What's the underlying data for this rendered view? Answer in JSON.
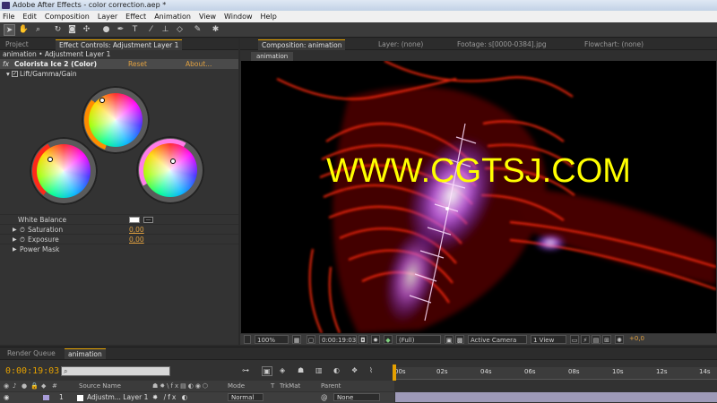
{
  "window": {
    "title": "Adobe After Effects - color correction.aep *"
  },
  "menu": [
    "File",
    "Edit",
    "Composition",
    "Layer",
    "Effect",
    "Animation",
    "View",
    "Window",
    "Help"
  ],
  "left_panel": {
    "tabs": {
      "project": "Project",
      "effect_controls": "Effect Controls: Adjustment Layer 1"
    },
    "breadcrumb": "animation • Adjustment Layer 1",
    "effect": {
      "prefix": "fx",
      "name": "Colorista Ice 2 (Color)",
      "reset": "Reset",
      "about": "About..."
    },
    "group": "Lift/Gamma/Gain",
    "props": [
      {
        "label": "White Balance",
        "value": ""
      },
      {
        "label": "Saturation",
        "value": "0,00"
      },
      {
        "label": "Exposure",
        "value": "0,00"
      },
      {
        "label": "Power Mask",
        "value": ""
      }
    ]
  },
  "right_panel": {
    "tabs": {
      "composition": "Composition: animation",
      "layer": "Layer: (none)",
      "footage": "Footage: s[0000-0384].jpg",
      "flowchart": "Flowchart: (none)"
    },
    "comp_label": "animation",
    "watermark": "WWW.CGTSJ.COM",
    "viewer_bar": {
      "zoom": "100%",
      "time": "0:00:19:03",
      "resolution": "(Full)",
      "camera": "Active Camera",
      "views": "1 View",
      "exposure": "+0,0"
    }
  },
  "timeline": {
    "tabs": {
      "render_queue": "Render Queue",
      "animation": "animation"
    },
    "timecode": "0:00:19:03",
    "ruler": [
      "00s",
      "02s",
      "04s",
      "06s",
      "08s",
      "10s",
      "12s",
      "14s"
    ],
    "columns": {
      "source": "Source Name",
      "mode": "Mode",
      "t": "T",
      "trkmat": "TrkMat",
      "parent": "Parent"
    },
    "layer": {
      "index": "1",
      "name": "Adjustm... Layer 1",
      "mode": "Normal",
      "parent": "None"
    }
  }
}
